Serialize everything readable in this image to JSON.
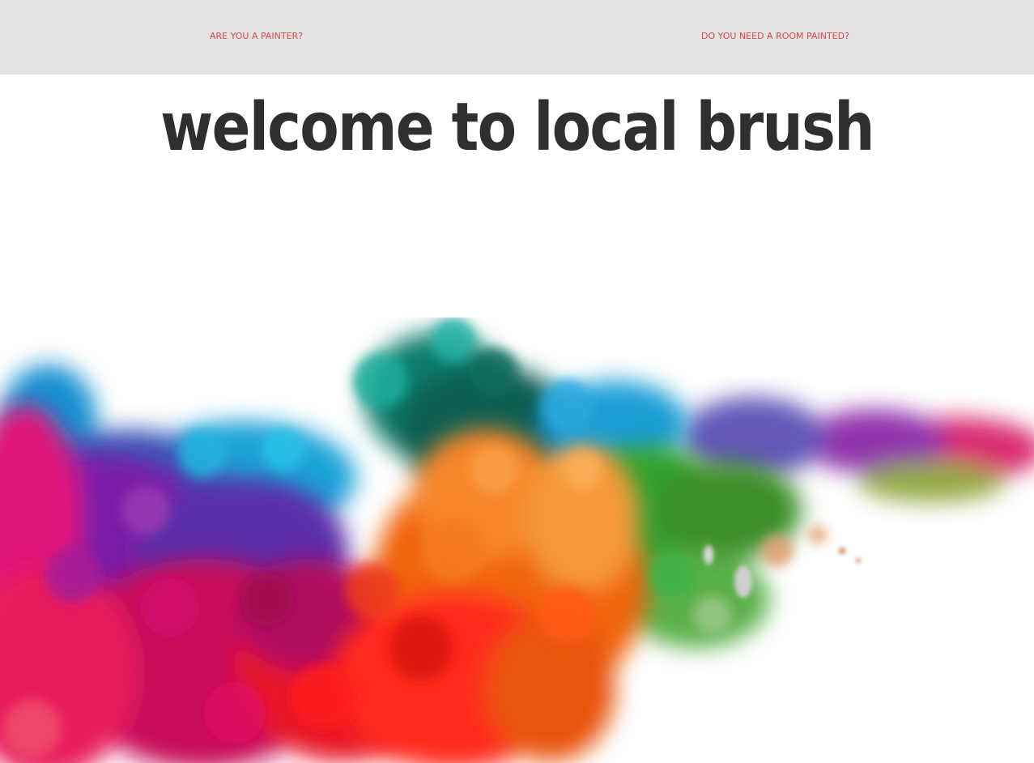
{
  "nav": {
    "painter_link": "ARE YOU A PAINTER?",
    "room_link": "DO YOU NEED A ROOM PAINTED?",
    "link_color": "#d94a47",
    "bar_color": "#e2e3e5"
  },
  "hero": {
    "title": "welcome to local brush",
    "title_color": "#2f2f2f"
  },
  "artwork": {
    "icon": "ink-splash-illustration",
    "colors": [
      "#e0137a",
      "#7a1fa6",
      "#1aa3d8",
      "#0a7d6d",
      "#f0650f",
      "#ff1a1a",
      "#2fa12f",
      "#8c2aa8",
      "#e81e5c"
    ]
  }
}
